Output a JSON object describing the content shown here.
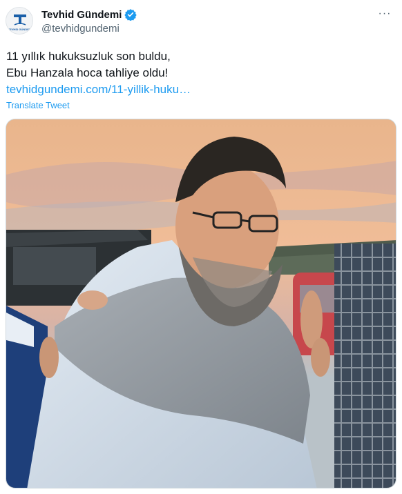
{
  "tweet": {
    "display_name": "Tevhid Gündemi",
    "handle": "@tevhidgundemi",
    "text_line1": "11 yıllık hukuksuzluk son buldu,",
    "text_line2": "Ebu Hanzala hoca tahliye oldu!",
    "link": "tevhidgundemi.com/11-yillik-huku…",
    "translate_label": "Translate Tweet",
    "more_glyph": "···"
  },
  "avatar": {
    "logo_text": "TEVHID GÜNDEMİ"
  },
  "icons": {
    "verified": "verified-badge-icon",
    "more": "more-options-icon"
  },
  "colors": {
    "accent": "#1d9bf0",
    "text": "#0f1419",
    "secondary": "#536471"
  }
}
